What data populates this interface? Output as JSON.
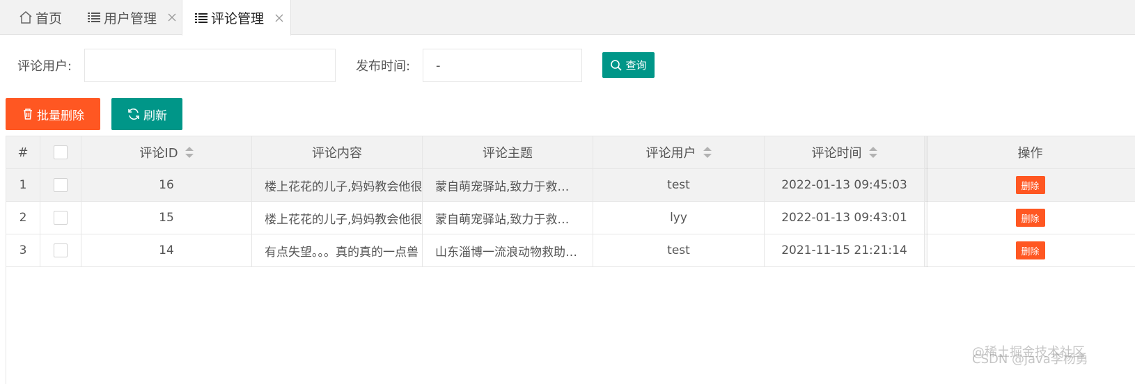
{
  "tabs": [
    {
      "label": "首页",
      "icon": "home-icon",
      "closable": false,
      "active": false
    },
    {
      "label": "用户管理",
      "icon": "list-icon",
      "closable": true,
      "active": false
    },
    {
      "label": "评论管理",
      "icon": "list-icon",
      "closable": true,
      "active": true
    }
  ],
  "search": {
    "user_label": "评论用户:",
    "user_value": "",
    "time_label": "发布时间:",
    "time_value": "-",
    "query_label": "查询"
  },
  "toolbar": {
    "batch_delete_label": "批量删除",
    "refresh_label": "刷新"
  },
  "table": {
    "headers": {
      "index": "#",
      "id": "评论ID",
      "content": "评论内容",
      "topic": "评论主题",
      "user": "评论用户",
      "time": "评论时间",
      "action": "操作"
    },
    "rows": [
      {
        "index": "1",
        "id": "16",
        "content": "楼上花花的儿子,妈妈教会他很",
        "topic": "蒙自萌宠驿站,致力于救…",
        "user": "test",
        "time": "2022-01-13 09:45:03",
        "action": "删除"
      },
      {
        "index": "2",
        "id": "15",
        "content": "楼上花花的儿子,妈妈教会他很",
        "topic": "蒙自萌宠驿站,致力于救…",
        "user": "lyy",
        "time": "2022-01-13 09:43:01",
        "action": "删除"
      },
      {
        "index": "3",
        "id": "14",
        "content": "有点失望。。。真的真的一点兽",
        "topic": "山东淄博一流浪动物救助…",
        "user": "test",
        "time": "2021-11-15 21:21:14",
        "action": "删除"
      }
    ]
  },
  "watermark": {
    "line1": "@稀土掘金技术社区",
    "line2": "CSDN @java李杨勇"
  },
  "colors": {
    "teal": "#009688",
    "orange": "#FF5722",
    "header_bg": "#f2f2f2",
    "border": "#e6e6e6"
  }
}
